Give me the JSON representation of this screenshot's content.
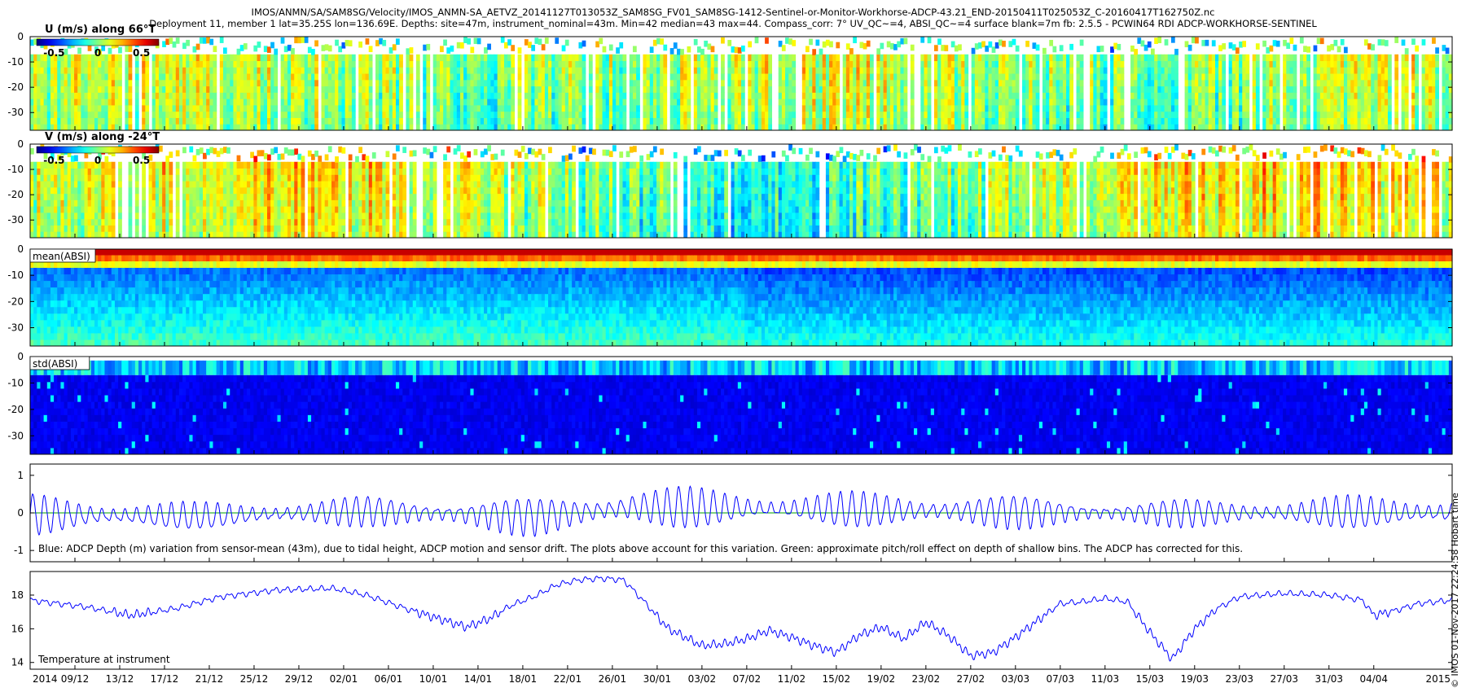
{
  "header": {
    "line1": "IMOS/ANMN/SA/SAM8SG/Velocity/IMOS_ANMN-SA_AETVZ_20141127T013053Z_SAM8SG_FV01_SAM8SG-1412-Sentinel-or-Monitor-Workhorse-ADCP-43.21_END-20150411T025053Z_C-20160417T162750Z.nc",
    "line2": "Deployment 11, member 1 lat=35.25S lon=136.69E. Depths: site=47m, instrument_nominal=43m. Min=42 median=43 max=44. Compass_corr: 7° UV_QC~=4, ABSI_QC~=4 surface blank=7m fb: 2.5.5 - PCWIN64 RDI ADCP-WORKHORSE-SENTINEL"
  },
  "side_text": "© IMOS 01-Nov-2017 22:24:58 Hobart time",
  "colors": {
    "depth_line": "#0000ff",
    "pitch_roll_line": "#00a000",
    "temperature_line": "#0000ff",
    "frame": "#000000"
  },
  "chart_data": [
    {
      "type": "heatmap",
      "title": "U (m/s) along 66°T",
      "colorbar_ticks": [
        "-0.5",
        "0",
        "0.5"
      ],
      "clim": [
        -0.7,
        0.7
      ],
      "colormap": "jet",
      "ylim": [
        -37,
        0
      ],
      "yticks": [
        0,
        -10,
        -20,
        -30
      ],
      "x_range": [
        "2014-12-05",
        "2015-04-11"
      ],
      "grid": false
    },
    {
      "type": "heatmap",
      "title": "V (m/s) along -24°T",
      "colorbar_ticks": [
        "-0.5",
        "0",
        "0.5"
      ],
      "clim": [
        -0.7,
        0.7
      ],
      "colormap": "jet",
      "ylim": [
        -37,
        0
      ],
      "yticks": [
        0,
        -10,
        -20,
        -30
      ],
      "x_range": [
        "2014-12-05",
        "2015-04-11"
      ],
      "grid": false
    },
    {
      "type": "heatmap",
      "title": "mean(ABSI)",
      "colormap": "jet",
      "ylim": [
        -37,
        0
      ],
      "yticks": [
        0,
        -10,
        -20,
        -30
      ],
      "x_range": [
        "2014-12-05",
        "2015-04-11"
      ],
      "grid": false
    },
    {
      "type": "heatmap",
      "title": "std(ABSI)",
      "colormap": "jet",
      "ylim": [
        -37,
        0
      ],
      "yticks": [
        0,
        -10,
        -20,
        -30
      ],
      "x_range": [
        "2014-12-05",
        "2015-04-11"
      ],
      "grid": false
    },
    {
      "type": "line",
      "annotation": "Blue: ADCP Depth (m) variation from sensor-mean (43m), due to tidal height, ADCP motion and sensor drift. The plots above account for this variation. Green: approximate pitch/roll effect on depth of shallow bins. The ADCP has corrected for this.",
      "ylim": [
        -1.3,
        1.3
      ],
      "yticks": [
        1,
        0,
        -1
      ],
      "series": [
        {
          "color": "#0000ff",
          "x": [
            "2014-12-05",
            "2014-12-20",
            "2015-01-04",
            "2015-01-19",
            "2015-01-28",
            "2015-02-10",
            "2015-02-25",
            "2015-03-12",
            "2015-03-27",
            "2015-04-11"
          ],
          "amplitude": [
            0.55,
            0.35,
            0.4,
            0.5,
            0.6,
            0.45,
            0.5,
            0.35,
            0.4,
            0.5
          ],
          "baseline": [
            -0.05,
            -0.1,
            0.05,
            -0.1,
            0.15,
            0.1,
            0.05,
            0.0,
            0.0,
            0.0
          ]
        },
        {
          "color": "#00a000",
          "values_constant": 0.0
        }
      ],
      "x_range": [
        "2014-12-05",
        "2015-04-11"
      ],
      "grid": false
    },
    {
      "type": "line",
      "annotation": "Temperature at instrument",
      "ylim": [
        13.6,
        19.4
      ],
      "yticks": [
        18,
        16,
        14
      ],
      "series": [
        {
          "color": "#0000ff",
          "x": [
            "2014-12-05",
            "2014-12-10",
            "2014-12-14",
            "2014-12-18",
            "2014-12-22",
            "2014-12-27",
            "2015-01-01",
            "2015-01-04",
            "2015-01-08",
            "2015-01-11",
            "2015-01-13",
            "2015-01-15",
            "2015-01-17",
            "2015-01-19",
            "2015-01-21",
            "2015-01-23",
            "2015-01-25",
            "2015-01-27",
            "2015-01-29",
            "2015-01-31",
            "2015-02-03",
            "2015-02-05",
            "2015-02-07",
            "2015-02-09",
            "2015-02-11",
            "2015-02-13",
            "2015-02-15",
            "2015-02-17",
            "2015-02-19",
            "2015-02-21",
            "2015-02-23",
            "2015-02-25",
            "2015-02-27",
            "2015-03-01",
            "2015-03-03",
            "2015-03-05",
            "2015-03-07",
            "2015-03-09",
            "2015-03-11",
            "2015-03-13",
            "2015-03-15",
            "2015-03-16",
            "2015-03-17",
            "2015-03-19",
            "2015-03-21",
            "2015-03-23",
            "2015-03-27",
            "2015-03-31",
            "2015-04-03",
            "2015-04-04",
            "2015-04-06",
            "2015-04-08",
            "2015-04-11"
          ],
          "values": [
            17.7,
            17.3,
            16.8,
            17.2,
            17.9,
            18.3,
            18.4,
            18.0,
            17.1,
            16.5,
            16.1,
            16.6,
            17.4,
            17.9,
            18.6,
            18.9,
            19.0,
            18.9,
            17.5,
            16.0,
            15.0,
            15.1,
            15.4,
            15.9,
            15.5,
            15.0,
            14.6,
            15.6,
            16.1,
            15.4,
            16.4,
            15.6,
            14.4,
            14.6,
            15.5,
            16.5,
            17.5,
            17.6,
            17.8,
            17.6,
            15.8,
            15.0,
            14.2,
            16.0,
            17.2,
            17.9,
            18.1,
            18.0,
            17.7,
            16.8,
            17.1,
            17.5,
            17.7
          ]
        }
      ],
      "x_range": [
        "2014-12-05",
        "2015-04-11"
      ],
      "grid": false
    }
  ],
  "xaxis": {
    "start": "2014-12-05",
    "end": "2015-04-11",
    "tick_labels": [
      "09/12",
      "13/12",
      "17/12",
      "21/12",
      "25/12",
      "29/12",
      "02/01",
      "06/01",
      "10/01",
      "14/01",
      "18/01",
      "22/01",
      "26/01",
      "30/01",
      "03/02",
      "07/02",
      "11/02",
      "15/02",
      "19/02",
      "23/02",
      "27/02",
      "03/03",
      "07/03",
      "11/03",
      "15/03",
      "19/03",
      "23/03",
      "27/03",
      "31/03",
      "04/04"
    ],
    "tick_dates": [
      "2014-12-09",
      "2014-12-13",
      "2014-12-17",
      "2014-12-21",
      "2014-12-25",
      "2014-12-29",
      "2015-01-02",
      "2015-01-06",
      "2015-01-10",
      "2015-01-14",
      "2015-01-18",
      "2015-01-22",
      "2015-01-26",
      "2015-01-30",
      "2015-02-03",
      "2015-02-07",
      "2015-02-11",
      "2015-02-15",
      "2015-02-19",
      "2015-02-23",
      "2015-02-27",
      "2015-03-03",
      "2015-03-07",
      "2015-03-11",
      "2015-03-15",
      "2015-03-19",
      "2015-03-23",
      "2015-03-27",
      "2015-03-31",
      "2015-04-04"
    ],
    "year_start": "2014",
    "year_end": "2015"
  }
}
